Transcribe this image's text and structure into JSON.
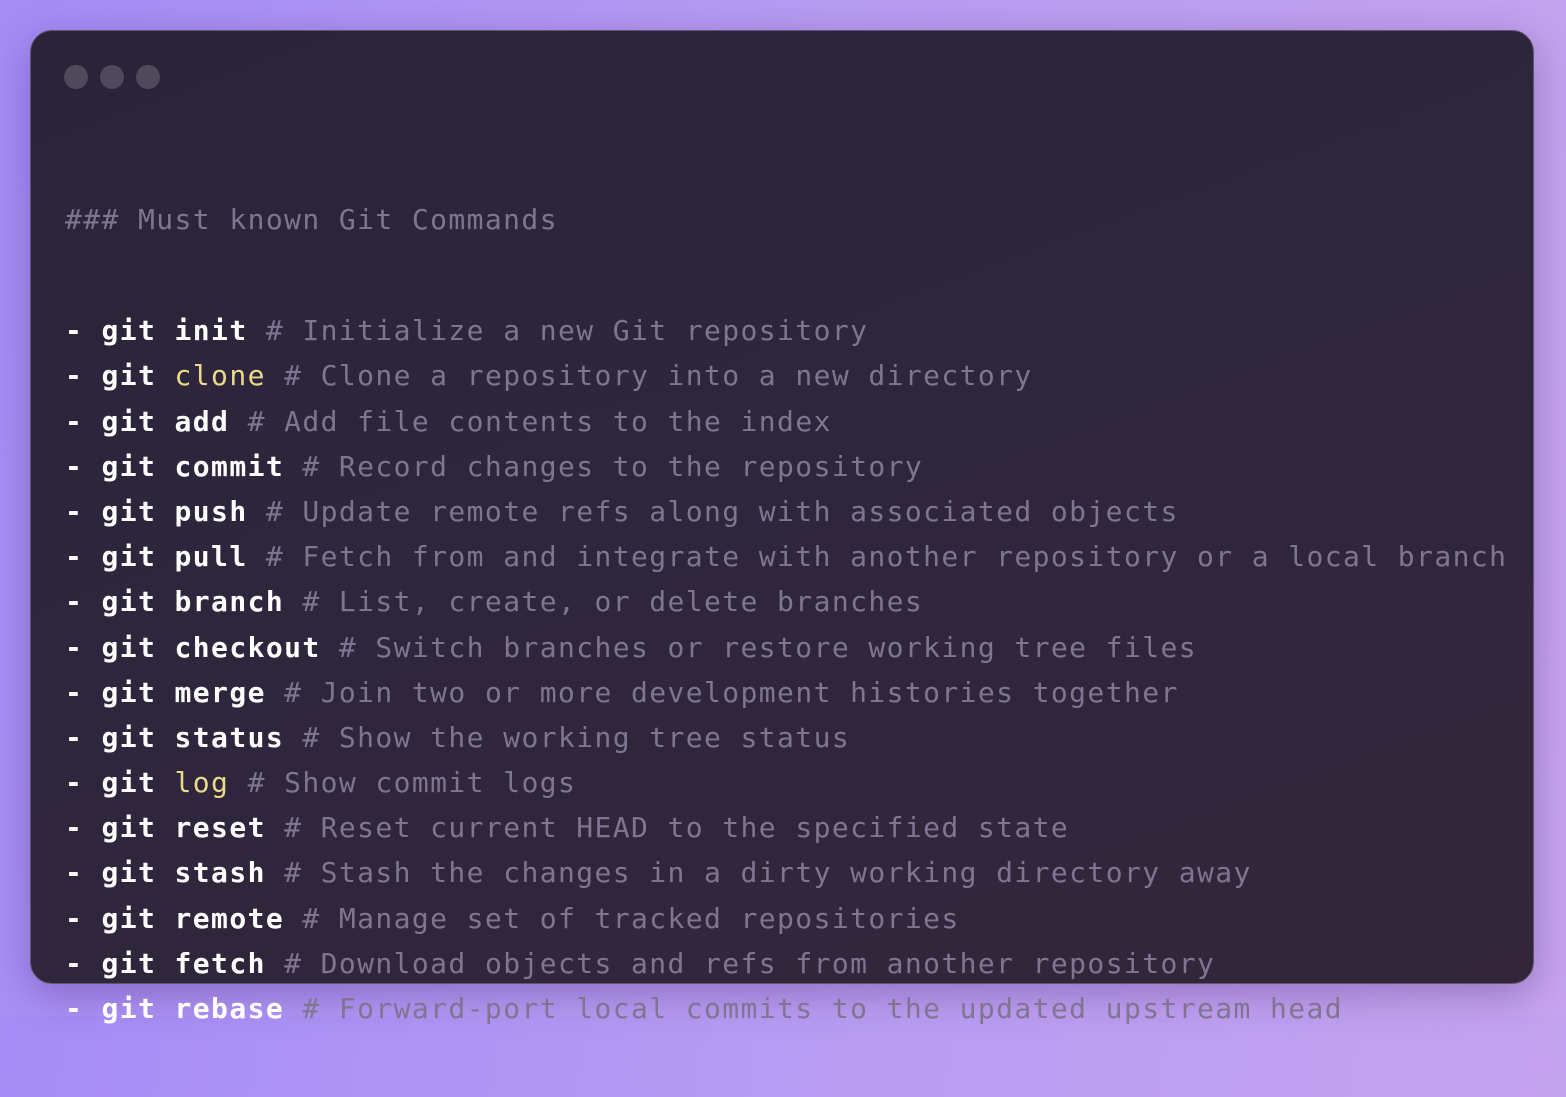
{
  "window": {
    "title_dots": [
      "dot-1",
      "dot-2",
      "dot-3"
    ]
  },
  "heading": "### Must known Git Commands",
  "prefix": "- git ",
  "commands": [
    {
      "cmd": "init",
      "comment": "# Initialize a new Git repository",
      "highlight": false
    },
    {
      "cmd": "clone",
      "comment": "# Clone a repository into a new directory",
      "highlight": true
    },
    {
      "cmd": "add",
      "comment": "# Add file contents to the index",
      "highlight": false
    },
    {
      "cmd": "commit",
      "comment": "# Record changes to the repository",
      "highlight": false
    },
    {
      "cmd": "push",
      "comment": "# Update remote refs along with associated objects",
      "highlight": false
    },
    {
      "cmd": "pull",
      "comment": "# Fetch from and integrate with another repository or a local branch",
      "highlight": false
    },
    {
      "cmd": "branch",
      "comment": "# List, create, or delete branches",
      "highlight": false
    },
    {
      "cmd": "checkout",
      "comment": "# Switch branches or restore working tree files",
      "highlight": false
    },
    {
      "cmd": "merge",
      "comment": "# Join two or more development histories together",
      "highlight": false
    },
    {
      "cmd": "status",
      "comment": "# Show the working tree status",
      "highlight": false
    },
    {
      "cmd": "log",
      "comment": "# Show commit logs",
      "highlight": true
    },
    {
      "cmd": "reset",
      "comment": "# Reset current HEAD to the specified state",
      "highlight": false
    },
    {
      "cmd": "stash",
      "comment": "# Stash the changes in a dirty working directory away",
      "highlight": false
    },
    {
      "cmd": "remote",
      "comment": "# Manage set of tracked repositories",
      "highlight": false
    },
    {
      "cmd": "fetch",
      "comment": "# Download objects and refs from another repository",
      "highlight": false
    },
    {
      "cmd": "rebase",
      "comment": "# Forward-port local commits to the updated upstream head",
      "highlight": false
    }
  ],
  "colors": {
    "background_start": "#a58cf6",
    "background_end": "#c7a4ee",
    "window_bg": "#2a2439",
    "command_text": "#ffffff",
    "comment_text": "#7f7591",
    "highlight_keyword": "#ebd98a"
  }
}
